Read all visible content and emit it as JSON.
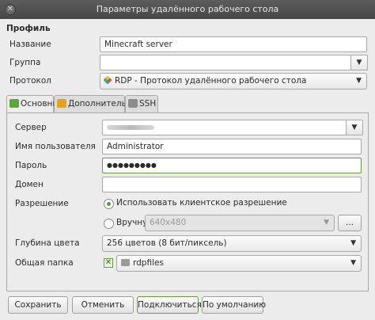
{
  "window": {
    "title": "Параметры удалённого рабочего стола",
    "close_glyph": "✕"
  },
  "profile": {
    "section_title": "Профиль",
    "name_label": "Название",
    "name_value": "Minecraft server",
    "group_label": "Группа",
    "group_value": "",
    "protocol_label": "Протокол",
    "protocol_value": "RDP - Протокол удалённого рабочего стола"
  },
  "tabs": [
    {
      "label": "Основные",
      "icon_color": "#5aa83a"
    },
    {
      "label": "Дополнительные",
      "icon_color": "#e8a21a"
    },
    {
      "label": "SSH",
      "icon_color": "#8c8c8c"
    }
  ],
  "basic": {
    "server_label": "Сервер",
    "username_label": "Имя пользователя",
    "username_value": "Administrator",
    "password_label": "Пароль",
    "password_value": "●●●●●●●●●",
    "domain_label": "Домен",
    "domain_value": "",
    "resolution_label": "Разрешение",
    "resolution_option_client": "Использовать клиентское разрешение",
    "resolution_option_manual": "Вручную",
    "resolution_manual_value": "640x480",
    "resolution_more_button": "...",
    "color_depth_label": "Глубина цвета",
    "color_depth_value": "256 цветов (8 бит/пиксель)",
    "shared_folder_label": "Общая папка",
    "shared_folder_value": "rdpfiles"
  },
  "buttons": {
    "save": "Сохранить",
    "cancel": "Отменить",
    "connect": "Подключиться",
    "default": "По умолчанию"
  },
  "icons": {
    "dropdown": "▼",
    "check": "✕"
  },
  "colors": {
    "accent": "#6b9a45",
    "titlebar": "#4f4f4f"
  }
}
